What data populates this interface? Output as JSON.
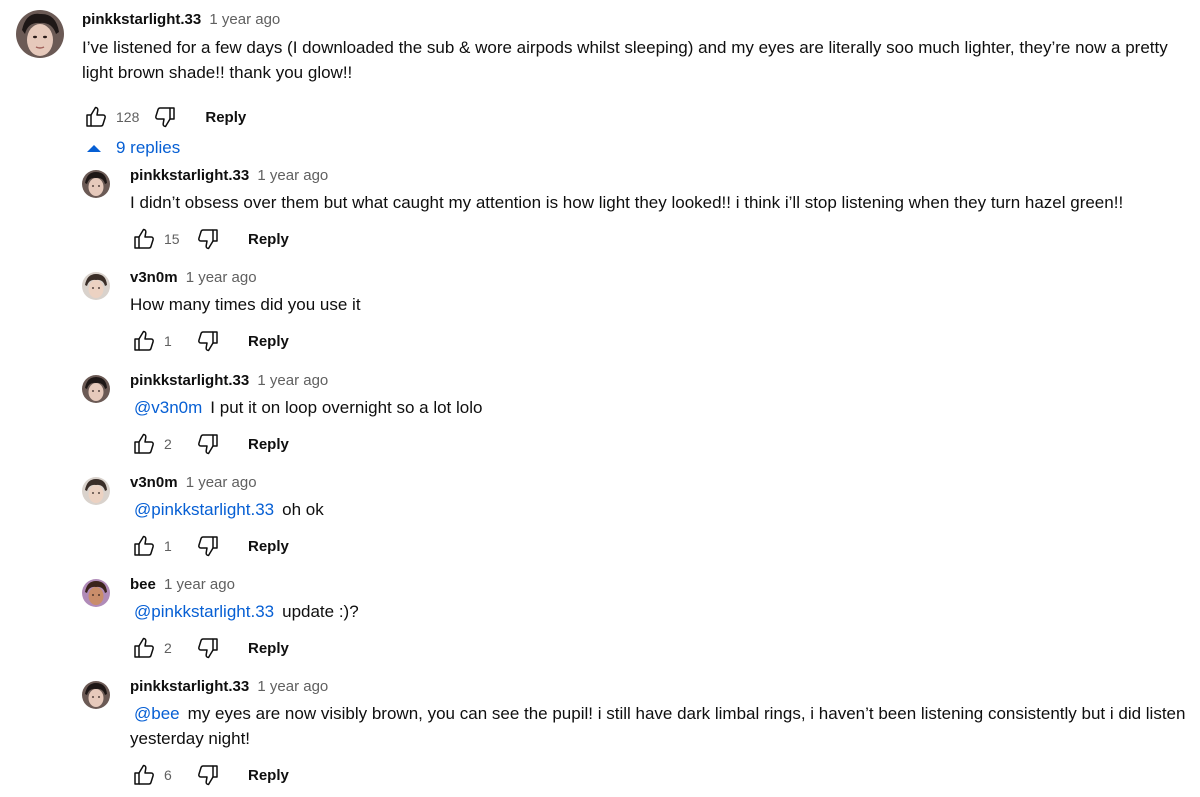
{
  "top_comment": {
    "author": "pinkkstarlight.33",
    "time": "1 year ago",
    "text": "I’ve listened for a few days (I downloaded the sub & wore airpods whilst sleeping) and my eyes are literally soo much lighter, they’re now a pretty light brown shade!! thank you glow!!",
    "likes": "128",
    "reply_label": "Reply"
  },
  "replies_toggle": {
    "label": "9 replies",
    "icon": "triangle-up-icon"
  },
  "replies": [
    {
      "author": "pinkkstarlight.33",
      "time": "1 year ago",
      "mention": "",
      "text": "I didn’t obsess over them but what caught my attention is how light they looked!! i think i’ll stop listening when they turn hazel green!!",
      "likes": "15",
      "reply_label": "Reply"
    },
    {
      "author": "v3n0m",
      "time": "1 year ago",
      "mention": "",
      "text": "How many times did you use it",
      "likes": "1",
      "reply_label": "Reply"
    },
    {
      "author": "pinkkstarlight.33",
      "time": "1 year ago",
      "mention": "@v3n0m",
      "text": "I put it on loop overnight so a lot lolo",
      "likes": "2",
      "reply_label": "Reply"
    },
    {
      "author": "v3n0m",
      "time": "1 year ago",
      "mention": "@pinkkstarlight.33",
      "text": "oh ok",
      "likes": "1",
      "reply_label": "Reply"
    },
    {
      "author": "bee",
      "time": "1 year ago",
      "mention": "@pinkkstarlight.33",
      "text": "update :)?",
      "likes": "2",
      "reply_label": "Reply"
    },
    {
      "author": "pinkkstarlight.33",
      "time": "1 year ago",
      "mention": "@bee",
      "text": "my eyes are now visibly brown, you can see the pupil! i still have dark limbal rings, i haven’t been listening consistently but i did listen yesterday night!",
      "likes": "6",
      "reply_label": "Reply"
    }
  ],
  "colors": {
    "link": "#065fd4",
    "meta_gray": "#606060",
    "text": "#0f0f0f"
  },
  "icons": {
    "like": "thumbs-up-icon",
    "dislike": "thumbs-down-icon"
  }
}
